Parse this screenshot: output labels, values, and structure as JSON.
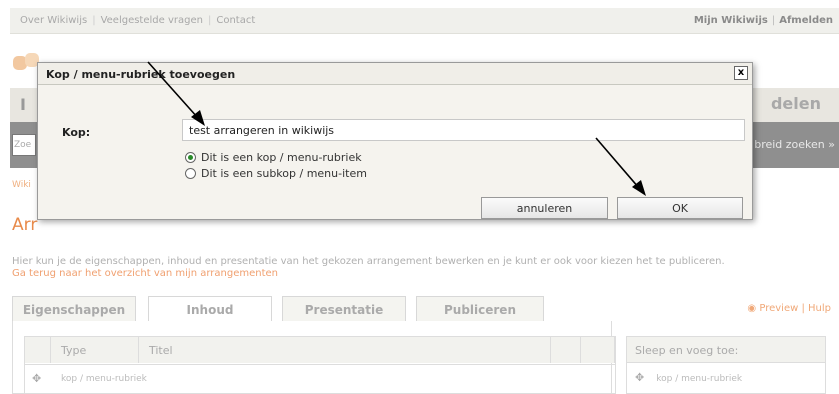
{
  "top": {
    "links": [
      "Over Wikiwijs",
      "Veelgestelde vragen",
      "Contact"
    ],
    "right_links": [
      "Mijn Wikiwijs",
      "Afmelden"
    ]
  },
  "nav": {
    "right_label": "delen",
    "left_label": "I"
  },
  "search": {
    "placeholder": "Zoe",
    "advanced": "breid zoeken »"
  },
  "breadcrumb": "Wiki",
  "page_title": "Arr",
  "description": "Hier kun je de eigenschappen, inhoud en presentatie van het gekozen arrangement bewerken en je kunt er ook voor kiezen het te publiceren.",
  "back_link": "Ga terug naar het overzicht van mijn arrangementen",
  "tabs": [
    {
      "label": "Eigenschappen"
    },
    {
      "label": "Inhoud"
    },
    {
      "label": "Presentatie"
    },
    {
      "label": "Publiceren"
    }
  ],
  "preview_links": {
    "preview": "Preview",
    "help": "Hulp"
  },
  "table": {
    "headers": [
      "Type",
      "Titel"
    ],
    "rows": [
      {
        "type": "kop / menu-rubriek"
      }
    ]
  },
  "side_panel": {
    "title": "Sleep en voeg toe:",
    "items": [
      "kop / menu-rubriek"
    ]
  },
  "dialog": {
    "title": "Kop / menu-rubriek toevoegen",
    "close": "x",
    "kop_label": "Kop:",
    "kop_value": "test arrangeren in wikiwijs",
    "radio_options": [
      {
        "label": "Dit is een kop / menu-rubriek",
        "selected": true
      },
      {
        "label": "Dit is een subkop / menu-item",
        "selected": false
      }
    ],
    "cancel_label": "annuleren",
    "ok_label": "OK"
  },
  "colors": {
    "accent": "#e88a4a",
    "dialog_bg": "#f5f3ee",
    "radio_on": "#2a8a2a"
  }
}
